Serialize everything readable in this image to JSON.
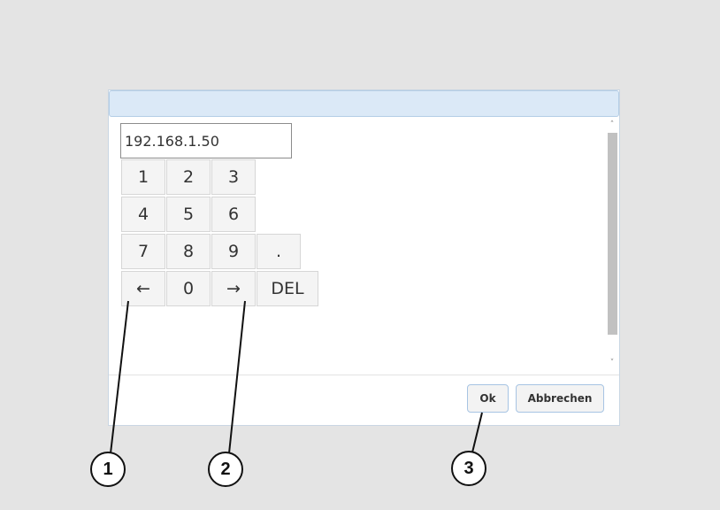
{
  "dialog": {
    "title": "",
    "ip_value": "192.168.1.50",
    "keypad": {
      "row1": [
        "1",
        "2",
        "3"
      ],
      "row2": [
        "4",
        "5",
        "6"
      ],
      "row3": [
        "7",
        "8",
        "9",
        "."
      ],
      "row4": [
        "←",
        "0",
        "→",
        "DEL"
      ]
    },
    "scroll_up": "˄",
    "scroll_down": "˅",
    "ok_label": "Ok",
    "cancel_label": "Abbrechen"
  },
  "callouts": [
    "1",
    "2",
    "3"
  ],
  "colors": {
    "background": "#e4e4e4",
    "titlebar": "#dbe9f7",
    "button_border": "#a7c4e3",
    "key_bg": "#f4f4f4"
  }
}
